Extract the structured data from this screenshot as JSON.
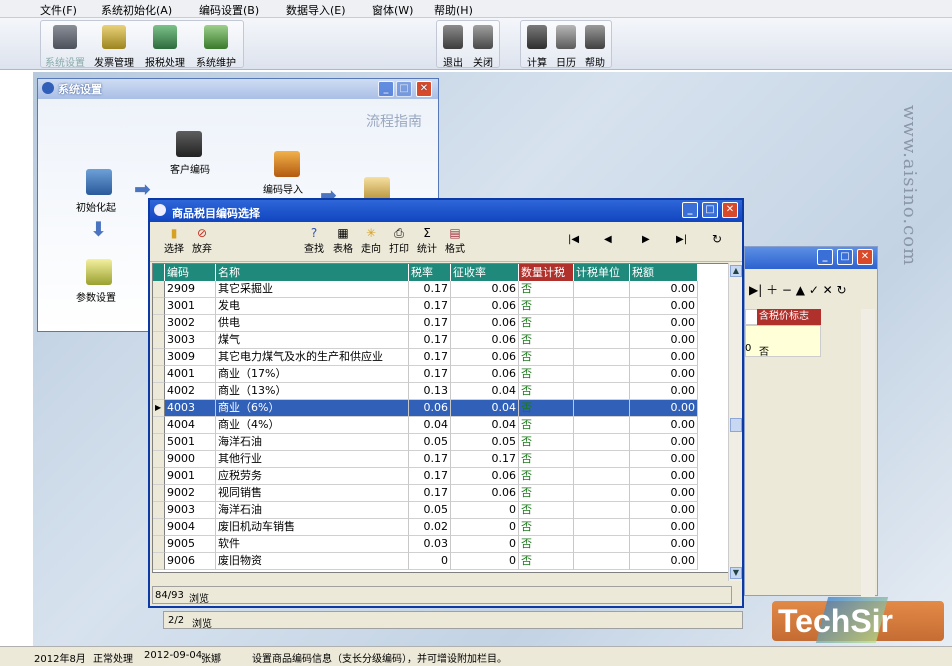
{
  "menu": [
    "文件(F)",
    "系统初始化(A)",
    "编码设置(B)",
    "数据导入(E)",
    "窗体(W)",
    "帮助(H)"
  ],
  "toolbar": {
    "left": [
      "系统设置",
      "发票管理",
      "报税处理",
      "系统维护"
    ],
    "mid": [
      "退出",
      "关闭"
    ],
    "right": [
      "计算",
      "日历",
      "帮助"
    ]
  },
  "watermark": "www.aisino.com",
  "sys_window": {
    "title": "系统设置",
    "flow_title": "流程指南",
    "nodes": [
      "客户编码",
      "初始化起",
      "编码导入",
      "参数设置"
    ]
  },
  "dialog": {
    "title": "商品税目编码选择",
    "tools_left": [
      "选择",
      "放弃"
    ],
    "tools_mid": [
      "查找",
      "表格",
      "走向",
      "打印",
      "统计",
      "格式"
    ],
    "nav": [
      "|◀",
      "◀",
      "▶",
      "▶|",
      "↻"
    ],
    "columns": [
      "编码",
      "名称",
      "税率",
      "征收率",
      "数量计税",
      "计税单位",
      "税额"
    ],
    "rows": [
      [
        "2909",
        "其它采掘业",
        "0.17",
        "0.06",
        "否",
        "",
        "0.00"
      ],
      [
        "3001",
        "发电",
        "0.17",
        "0.06",
        "否",
        "",
        "0.00"
      ],
      [
        "3002",
        "供电",
        "0.17",
        "0.06",
        "否",
        "",
        "0.00"
      ],
      [
        "3003",
        "煤气",
        "0.17",
        "0.06",
        "否",
        "",
        "0.00"
      ],
      [
        "3009",
        "其它电力煤气及水的生产和供应业",
        "0.17",
        "0.06",
        "否",
        "",
        "0.00"
      ],
      [
        "4001",
        "商业（17%）",
        "0.17",
        "0.06",
        "否",
        "",
        "0.00"
      ],
      [
        "4002",
        "商业（13%）",
        "0.13",
        "0.04",
        "否",
        "",
        "0.00"
      ],
      [
        "4003",
        "商业（6%）",
        "0.06",
        "0.04",
        "否",
        "",
        "0.00"
      ],
      [
        "4004",
        "商业（4%）",
        "0.04",
        "0.04",
        "否",
        "",
        "0.00"
      ],
      [
        "5001",
        "海洋石油",
        "0.05",
        "0.05",
        "否",
        "",
        "0.00"
      ],
      [
        "9000",
        "其他行业",
        "0.17",
        "0.17",
        "否",
        "",
        "0.00"
      ],
      [
        "9001",
        "应税劳务",
        "0.17",
        "0.06",
        "否",
        "",
        "0.00"
      ],
      [
        "9002",
        "视同销售",
        "0.17",
        "0.06",
        "否",
        "",
        "0.00"
      ],
      [
        "9003",
        "海洋石油",
        "0.05",
        "0",
        "否",
        "",
        "0.00"
      ],
      [
        "9004",
        "废旧机动车销售",
        "0.02",
        "0",
        "否",
        "",
        "0.00"
      ],
      [
        "9005",
        "软件",
        "0.03",
        "0",
        "否",
        "",
        "0.00"
      ],
      [
        "9006",
        "废旧物资",
        "0",
        "0",
        "否",
        "",
        "0.00"
      ]
    ],
    "selected_row": 7,
    "record": "84/93",
    "browse": "浏览"
  },
  "side_window": {
    "header": "含税价标志",
    "cell_left": "0",
    "cell_value": "否",
    "page": "2/2",
    "browse": "浏览"
  },
  "status": [
    "2012年8月",
    "正常处理",
    "2012-09-04",
    "张娜",
    "设置商品编码信息（支长分级编码），并可增设附加栏目。"
  ],
  "logo": "TechSir"
}
